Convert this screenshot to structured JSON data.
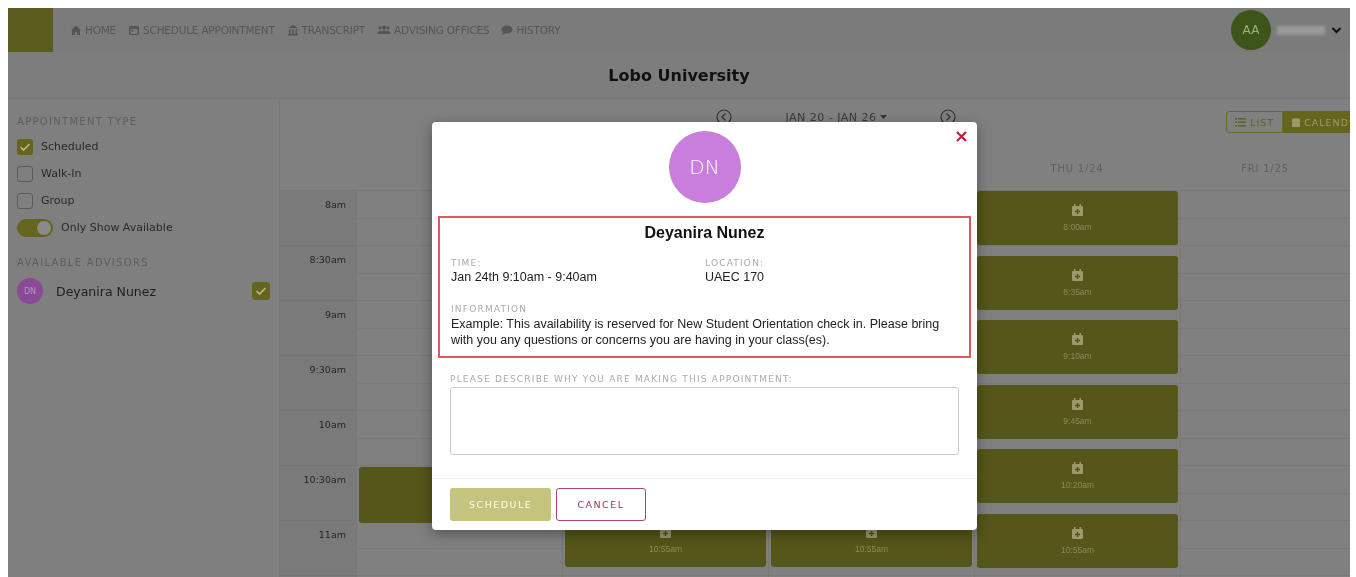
{
  "nav": {
    "items": [
      {
        "label": "HOME"
      },
      {
        "label": "SCHEDULE APPOINTMENT"
      },
      {
        "label": "TRANSCRIPT"
      },
      {
        "label": "ADVISING OFFICES"
      },
      {
        "label": "HISTORY"
      }
    ],
    "user": {
      "initials": "AA"
    }
  },
  "title": "Lobo University",
  "sidebar": {
    "type_heading": "APPOINTMENT TYPE",
    "options": [
      {
        "label": "Scheduled",
        "checked": true
      },
      {
        "label": "Walk-In",
        "checked": false
      },
      {
        "label": "Group",
        "checked": false
      }
    ],
    "toggle": {
      "label": "Only Show Available",
      "on": true
    },
    "advisors_heading": "AVAILABLE ADVISORS",
    "advisors": [
      {
        "initials": "DN",
        "name": "Deyanira Nunez",
        "checked": true
      }
    ]
  },
  "calendar": {
    "range": "JAN 20 - JAN 26",
    "views": [
      {
        "label": "LIST",
        "selected": false
      },
      {
        "label": "CALEND",
        "selected": true
      }
    ],
    "times": [
      "8am",
      "8:30am",
      "9am",
      "9:30am",
      "10am",
      "10:30am",
      "11am"
    ],
    "days": [
      {
        "slots": [
          {
            "kind": "block"
          }
        ]
      },
      {
        "slots": [
          {
            "kind": "block",
            "time": "10:55am"
          }
        ]
      },
      {
        "slots": [
          {
            "kind": "block",
            "time": "10:55am"
          }
        ]
      },
      {
        "label": "THU 1/24",
        "slots": [
          {
            "kind": "block",
            "time": "8:00am"
          },
          {
            "kind": "block",
            "time": "8:35am"
          },
          {
            "kind": "block",
            "time": "9:10am"
          },
          {
            "kind": "block",
            "time": "9:45am"
          },
          {
            "kind": "block",
            "time": "10:20am"
          },
          {
            "kind": "block",
            "time": "10:55am"
          }
        ]
      },
      {
        "label": "FRI 1/25"
      }
    ]
  },
  "modal": {
    "initials": "DN",
    "name": "Deyanira Nunez",
    "time_label": "TIME:",
    "time": "Jan 24th 9:10am - 9:40am",
    "location_label": "LOCATION:",
    "location": "UAEC 170",
    "information_label": "INFORMATION",
    "information": "Example: This availability is reserved for New Student Orientation check in. Please bring with you any questions or concerns you are having in your class(es).",
    "reason_label": "PLEASE DESCRIBE WHY YOU ARE MAKING THIS APPOINTMENT:",
    "buttons": [
      {
        "kind": "primary",
        "label": "SCHEDULE",
        "disabled": true
      },
      {
        "kind": "secondary",
        "label": "CANCEL",
        "disabled": false
      }
    ]
  }
}
